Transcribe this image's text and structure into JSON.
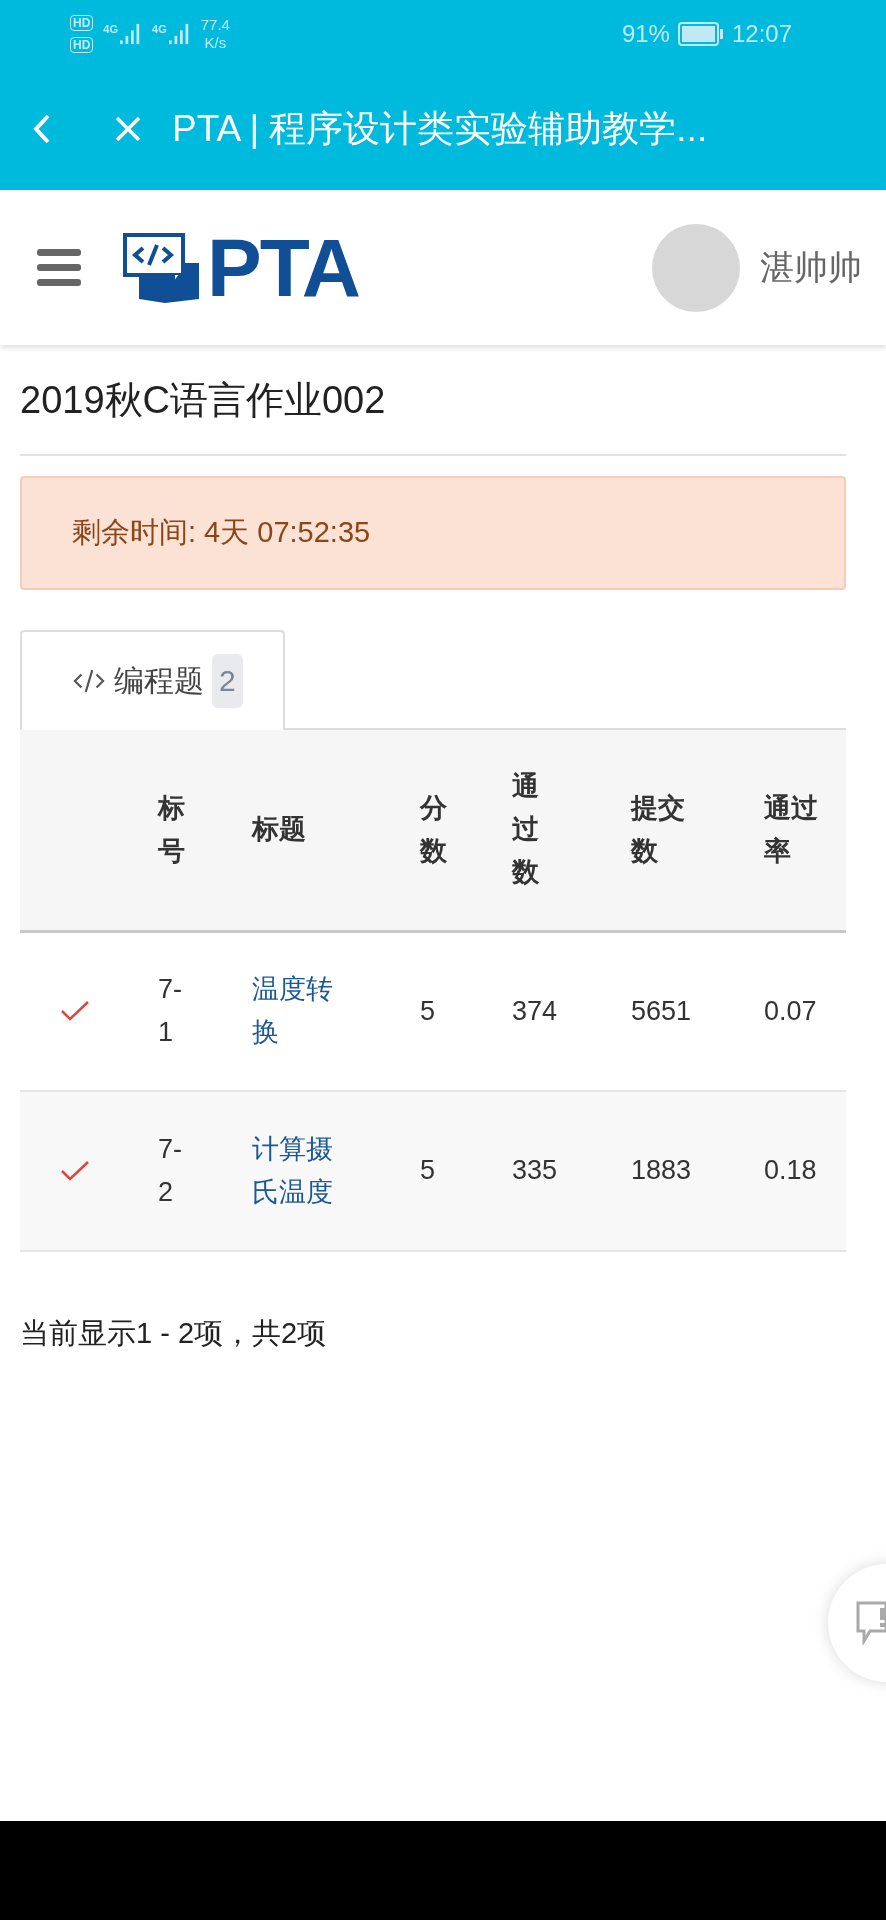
{
  "status_bar": {
    "sim_labels": [
      "HD",
      "HD"
    ],
    "network_labels": [
      "4G",
      "4G"
    ],
    "speed": "77.4",
    "speed_unit": "K/s",
    "battery": "91%",
    "time": "12:07"
  },
  "browser_bar": {
    "title": "PTA | 程序设计类实验辅助教学..."
  },
  "header": {
    "logo_text": "PTA",
    "user_name": "湛帅帅"
  },
  "page_title": "2019秋C语言作业002",
  "alert": {
    "text": "剩余时间: 4天 07:52:35"
  },
  "tabs": [
    {
      "label": "编程题",
      "count": "2",
      "selected": true
    }
  ],
  "table": {
    "columns": [
      "",
      "标号",
      "标题",
      "分数",
      "通过数",
      "提交数",
      "通过率"
    ],
    "rows": [
      {
        "passed": true,
        "number": "7-1",
        "title": "温度转换",
        "score": "5",
        "passes": "374",
        "submissions": "5651",
        "rate": "0.07"
      },
      {
        "passed": true,
        "number": "7-2",
        "title": "计算摄氏温度",
        "score": "5",
        "passes": "335",
        "submissions": "1883",
        "rate": "0.18"
      }
    ]
  },
  "footer_text": "当前显示1 - 2项，共2项"
}
